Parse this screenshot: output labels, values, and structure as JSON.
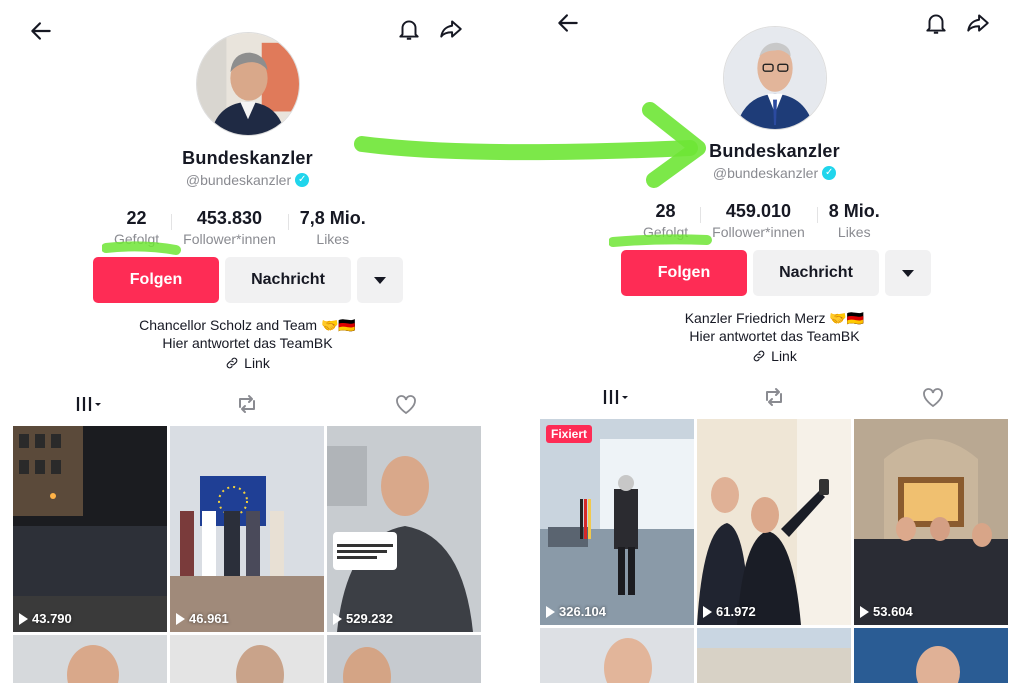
{
  "colors": {
    "accent": "#fe2c55",
    "verified": "#20d5ec",
    "highlighter": "#6ee535"
  },
  "left": {
    "icons": {
      "back": "arrow-left-icon",
      "bell": "bell-icon",
      "share": "share-icon"
    },
    "name": "Bundeskanzler",
    "handle": "@bundeskanzler",
    "stats": {
      "following_value": "22",
      "following_label": "Gefolgt",
      "followers_value": "453.830",
      "followers_label": "Follower*innen",
      "likes_value": "7,8 Mio.",
      "likes_label": "Likes"
    },
    "buttons": {
      "follow": "Folgen",
      "message": "Nachricht"
    },
    "bio_line1": "Chancellor Scholz and Team 🤝🇩🇪",
    "bio_line2": "Hier antwortet das TeamBK",
    "link_label": "Link",
    "videos": [
      {
        "views": "43.790"
      },
      {
        "views": "46.961"
      },
      {
        "views": "529.232",
        "overlay_q": "Was machen Sie nach ihrer Zeit als Bundeskanzler?",
        "overlay_caption": "Was machen Sie nach ihrer Zeit als Bundeskanzler"
      }
    ]
  },
  "right": {
    "name": "Bundeskanzler",
    "handle": "@bundeskanzler",
    "stats": {
      "following_value": "28",
      "following_label": "Gefolgt",
      "followers_value": "459.010",
      "followers_label": "Follower*innen",
      "likes_value": "8 Mio.",
      "likes_label": "Likes"
    },
    "buttons": {
      "follow": "Folgen",
      "message": "Nachricht"
    },
    "bio_line1": "Kanzler Friedrich Merz 🤝🇩🇪",
    "bio_line2": "Hier antwortet das TeamBK",
    "link_label": "Link",
    "pinned_label": "Fixiert",
    "videos": [
      {
        "views": "326.104"
      },
      {
        "views": "61.972"
      },
      {
        "views": "53.604"
      }
    ]
  }
}
